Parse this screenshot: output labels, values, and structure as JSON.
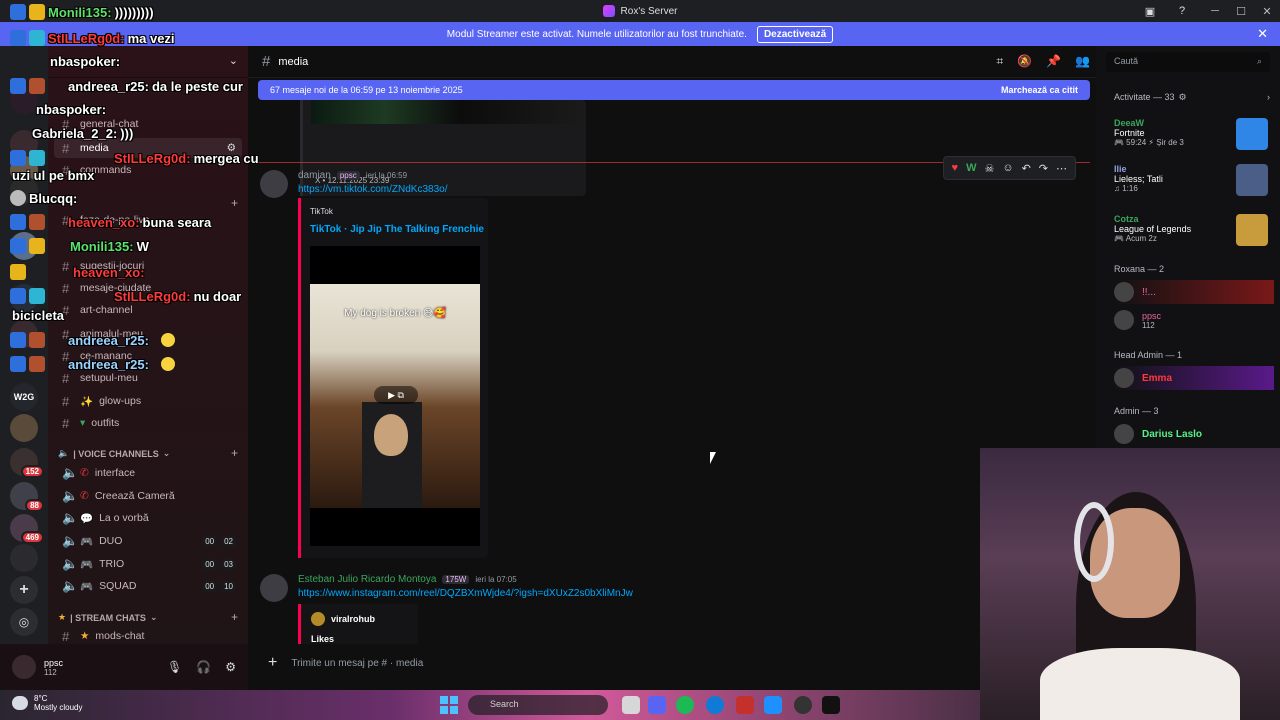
{
  "window": {
    "title": "Rox's Server"
  },
  "banner": {
    "text": "Modul Streamer este activat. Numele utilizatorilor au fost trunchiate.",
    "button": "Dezactivează"
  },
  "rail": {
    "badges": [
      "152",
      "88",
      "469"
    ]
  },
  "channels": {
    "items": [
      {
        "name": "general-chat"
      },
      {
        "name": "media",
        "active": true
      },
      {
        "name": "commands"
      },
      {
        "name": "faze-de-pe-live"
      },
      {
        "name": "sugestii-jocuri"
      },
      {
        "name": "mesaje-ciudate"
      },
      {
        "name": "art-channel"
      },
      {
        "name": "animalul-meu"
      },
      {
        "name": "ce-mananc"
      },
      {
        "name": "setupul-meu"
      },
      {
        "name": "glow-ups"
      },
      {
        "name": "outfits"
      }
    ],
    "voice_category": "| VOICE CHANNELS",
    "voice": [
      {
        "name": "interface"
      },
      {
        "name": "Creează Cameră"
      },
      {
        "name": "La o vorbă"
      },
      {
        "name": "DUO",
        "c1": "00",
        "c2": "02"
      },
      {
        "name": "TRIO",
        "c1": "00",
        "c2": "03"
      },
      {
        "name": "SQUAD",
        "c1": "00",
        "c2": "10"
      }
    ],
    "stream_category": "| STREAM CHATS",
    "stream": [
      {
        "name": "mods-chat"
      }
    ]
  },
  "user_panel": {
    "name": "ppsc",
    "status": "112"
  },
  "chat": {
    "channel": "media",
    "new_messages": "67 mesaje noi de la 06:59 pe 13 noiembrie 2025",
    "mark_read": "Marchează ca citit",
    "tweet_footer": "X • 12.11.2025 23:39",
    "msg1": {
      "author": "damian",
      "tag": "ppsc",
      "time": "ieri la 06:59",
      "link": "https://vm.tiktok.com/ZNdKc383o/",
      "embed_provider": "TikTok",
      "embed_title": "TikTok · Jip Jip The Talking Frenchie",
      "video_caption": "My dog is broken 😅🥰"
    },
    "msg2": {
      "author": "Esteban Julio Ricardo Montoya",
      "tag": "175W",
      "time": "ieri la 07:05",
      "link": "https://www.instagram.com/reel/DQZBXmWjde4/?igsh=dXUxZ2s0bXliMnJw",
      "embed_account": "viralrohub",
      "embed_likes": "Likes"
    },
    "composer_placeholder": "Trimite un mesaj pe #",
    "composer_channel": "media"
  },
  "members": {
    "search_placeholder": "Caută",
    "activity_header": "Activitate — 33",
    "activities": [
      {
        "name": "DeeaW",
        "game": "Fortnite",
        "detail": "🎮 59:24  ⚡ Șir de 3"
      },
      {
        "name": "Ilie",
        "game": "Lieless; Tatli",
        "detail": "♫ 1:16"
      },
      {
        "name": "Cotza",
        "game": "League of Legends",
        "detail": "🎮 Acum 2z"
      }
    ],
    "groups": [
      {
        "title": "Roxana — 2",
        "members": [
          {
            "name": "!!..."
          },
          {
            "name": "ppsc",
            "sub": "112"
          }
        ]
      },
      {
        "title": "Head Admin — 1",
        "members": [
          {
            "name": "Emma"
          }
        ]
      },
      {
        "title": "Admin — 3",
        "members": [
          {
            "name": "Darius Laslo"
          }
        ]
      }
    ]
  },
  "taskbar": {
    "temp": "8°C",
    "weather": "Mostly cloudy",
    "search": "Search"
  },
  "overlay": {
    "lines": [
      {
        "who": "Monili135:",
        "text": ")))))))))"
      },
      {
        "who": "StILLeRg0d:",
        "text": "ma vezi"
      },
      {
        "who": "nbaspoker:",
        "text": ""
      },
      {
        "who": "andreea_r25:",
        "text": "da le peste cur"
      },
      {
        "who": "nbaspoker:",
        "text": ""
      },
      {
        "who": "Gabriela_2_2:",
        "text": ")))"
      },
      {
        "who": "StILLeRg0d:",
        "text": "mergea cu"
      },
      {
        "who": "",
        "text": "uzi ul pe bmx"
      },
      {
        "who": "Blucqq:",
        "text": ""
      },
      {
        "who": "heaven_xo:",
        "text": "buna seara"
      },
      {
        "who": "Monili135:",
        "text": "W"
      },
      {
        "who": "heaven_xo:",
        "text": ""
      },
      {
        "who": "StILLeRg0d:",
        "text": "nu doar"
      },
      {
        "who": "",
        "text": "bicicleta"
      },
      {
        "who": "andreea_r25:",
        "text": ""
      },
      {
        "who": "andreea_r25:",
        "text": ""
      }
    ]
  }
}
